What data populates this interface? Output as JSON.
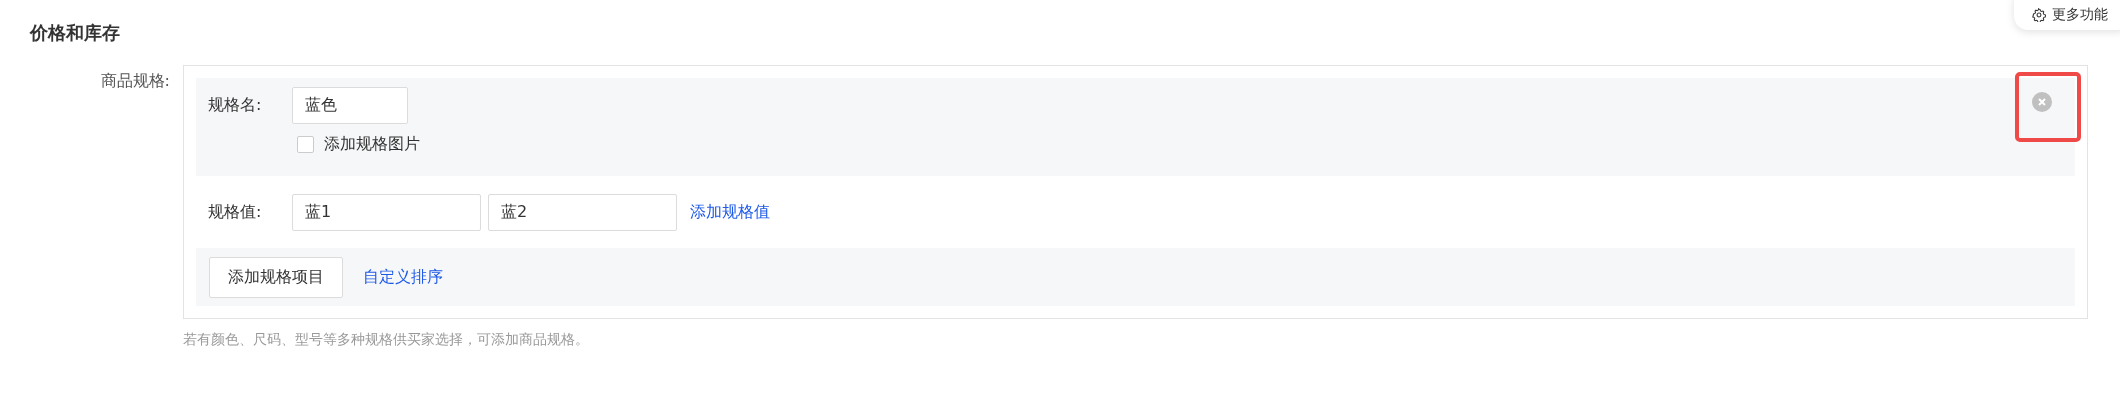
{
  "section_title": "价格和库存",
  "more_button": {
    "label": "更多功能"
  },
  "field_label": "商品规格:",
  "spec_item": {
    "name_label": "规格名:",
    "name_value": "蓝色",
    "image_option": {
      "label": "添加规格图片",
      "checked": false
    },
    "values_label": "规格值:",
    "values": [
      {
        "value": "蓝1"
      },
      {
        "value": "蓝2"
      }
    ],
    "add_value_link": "添加规格值",
    "highlighted_remove": true
  },
  "add_item_button": "添加规格项目",
  "sort_link": "自定义排序",
  "hint": "若有颜色、尺码、型号等多种规格供买家选择，可添加商品规格。"
}
